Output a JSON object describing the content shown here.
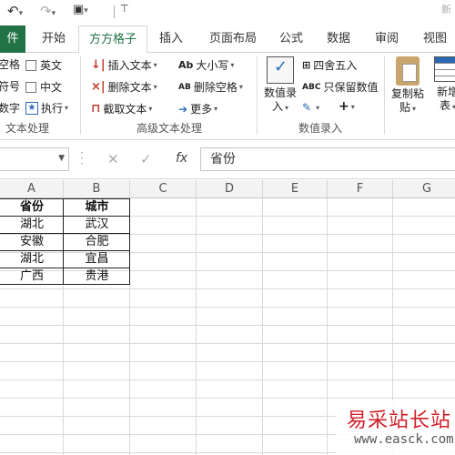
{
  "qat": {
    "undo_icon": "undo-arrow",
    "redo_icon": "redo-arrow",
    "title_fragment": "新"
  },
  "tabs": [
    {
      "label": "件"
    },
    {
      "label": "开始"
    },
    {
      "label": "方方格子"
    },
    {
      "label": "插入"
    },
    {
      "label": "页面布局"
    },
    {
      "label": "公式"
    },
    {
      "label": "数据"
    },
    {
      "label": "审阅"
    },
    {
      "label": "视图"
    }
  ],
  "ribbon": {
    "text_group": {
      "items": [
        "空格",
        "符号",
        "数字"
      ],
      "checks": [
        "英文",
        "中文"
      ],
      "execute": "执行",
      "label": "文本处理"
    },
    "advanced_group": {
      "insert_text": "插入文本",
      "delete_text": "删除文本",
      "cut_text": "截取文本",
      "case": "大小写",
      "delete_space": "删除空格",
      "more": "更多",
      "label": "高级文本处理"
    },
    "value_group": {
      "value_entry_line1": "数值录",
      "value_entry_line2": "入",
      "round": "四舍五入",
      "keep_value": "只保留数值",
      "label": "数值录入"
    },
    "clip_group": {
      "paste_line1": "复制粘",
      "paste_line2": "贴",
      "new_line1": "新增",
      "new_line2": "表"
    }
  },
  "formula_bar": {
    "fx": "fx",
    "content": "省份"
  },
  "columns": [
    "A",
    "B",
    "C",
    "D",
    "E",
    "F",
    "G"
  ],
  "table": {
    "headers": [
      "省份",
      "城市"
    ],
    "rows": [
      [
        "湖北",
        "武汉"
      ],
      [
        "安徽",
        "合肥"
      ],
      [
        "湖北",
        "宜昌"
      ],
      [
        "广西",
        "贵港"
      ]
    ]
  },
  "watermark": {
    "title": "易采站长站",
    "url": "www.easck.com"
  }
}
